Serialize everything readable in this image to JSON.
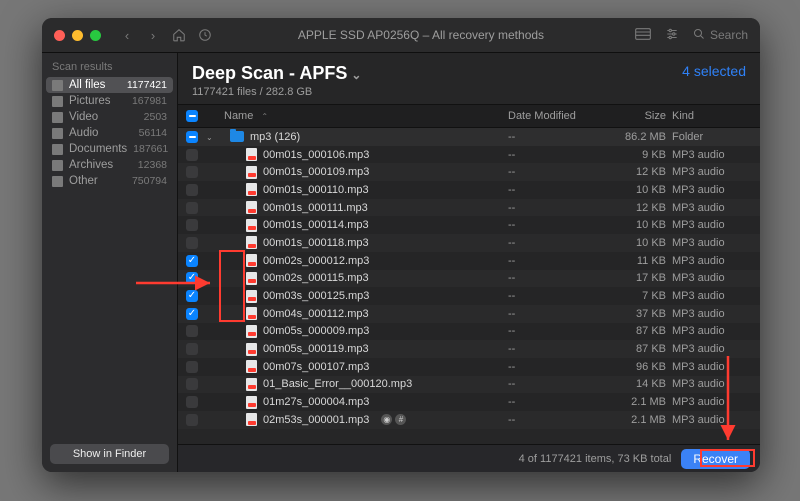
{
  "titlebar": {
    "title": "APPLE SSD AP0256Q – All recovery methods",
    "search_placeholder": "Search"
  },
  "sidebar": {
    "header": "Scan results",
    "items": [
      {
        "label": "All files",
        "count": "1177421"
      },
      {
        "label": "Pictures",
        "count": "167981"
      },
      {
        "label": "Video",
        "count": "2503"
      },
      {
        "label": "Audio",
        "count": "56114"
      },
      {
        "label": "Documents",
        "count": "187661"
      },
      {
        "label": "Archives",
        "count": "12368"
      },
      {
        "label": "Other",
        "count": "750794"
      }
    ],
    "finder_button": "Show in Finder"
  },
  "content": {
    "title": "Deep Scan - APFS",
    "subtitle": "1177421 files / 282.8 GB",
    "selected_label": "4 selected"
  },
  "columns": {
    "name": "Name",
    "date": "Date Modified",
    "size": "Size",
    "kind": "Kind"
  },
  "rows": [
    {
      "check": "head",
      "disclosure": "down",
      "icon": "folder",
      "depth": 0,
      "name": "mp3 (126)",
      "date": "--",
      "size": "86.2 MB",
      "kind": "Folder",
      "folder": true,
      "badges": false
    },
    {
      "check": "off",
      "disclosure": "",
      "icon": "file",
      "depth": 1,
      "name": "00m01s_000106.mp3",
      "date": "--",
      "size": "9 KB",
      "kind": "MP3 audio",
      "badges": false
    },
    {
      "check": "off",
      "disclosure": "",
      "icon": "file",
      "depth": 1,
      "name": "00m01s_000109.mp3",
      "date": "--",
      "size": "12 KB",
      "kind": "MP3 audio",
      "badges": false
    },
    {
      "check": "off",
      "disclosure": "",
      "icon": "file",
      "depth": 1,
      "name": "00m01s_000110.mp3",
      "date": "--",
      "size": "10 KB",
      "kind": "MP3 audio",
      "badges": false
    },
    {
      "check": "off",
      "disclosure": "",
      "icon": "file",
      "depth": 1,
      "name": "00m01s_000111.mp3",
      "date": "--",
      "size": "12 KB",
      "kind": "MP3 audio",
      "badges": false
    },
    {
      "check": "off",
      "disclosure": "",
      "icon": "file",
      "depth": 1,
      "name": "00m01s_000114.mp3",
      "date": "--",
      "size": "10 KB",
      "kind": "MP3 audio",
      "badges": false
    },
    {
      "check": "off",
      "disclosure": "",
      "icon": "file",
      "depth": 1,
      "name": "00m01s_000118.mp3",
      "date": "--",
      "size": "10 KB",
      "kind": "MP3 audio",
      "badges": false
    },
    {
      "check": "on",
      "disclosure": "",
      "icon": "file",
      "depth": 1,
      "name": "00m02s_000012.mp3",
      "date": "--",
      "size": "11 KB",
      "kind": "MP3 audio",
      "badges": false
    },
    {
      "check": "on",
      "disclosure": "",
      "icon": "file",
      "depth": 1,
      "name": "00m02s_000115.mp3",
      "date": "--",
      "size": "17 KB",
      "kind": "MP3 audio",
      "badges": false
    },
    {
      "check": "on",
      "disclosure": "",
      "icon": "file",
      "depth": 1,
      "name": "00m03s_000125.mp3",
      "date": "--",
      "size": "7 KB",
      "kind": "MP3 audio",
      "badges": false
    },
    {
      "check": "on",
      "disclosure": "",
      "icon": "file",
      "depth": 1,
      "name": "00m04s_000112.mp3",
      "date": "--",
      "size": "37 KB",
      "kind": "MP3 audio",
      "badges": false
    },
    {
      "check": "off",
      "disclosure": "",
      "icon": "file",
      "depth": 1,
      "name": "00m05s_000009.mp3",
      "date": "--",
      "size": "87 KB",
      "kind": "MP3 audio",
      "badges": false
    },
    {
      "check": "off",
      "disclosure": "",
      "icon": "file",
      "depth": 1,
      "name": "00m05s_000119.mp3",
      "date": "--",
      "size": "87 KB",
      "kind": "MP3 audio",
      "badges": false
    },
    {
      "check": "off",
      "disclosure": "",
      "icon": "file",
      "depth": 1,
      "name": "00m07s_000107.mp3",
      "date": "--",
      "size": "96 KB",
      "kind": "MP3 audio",
      "badges": false
    },
    {
      "check": "off",
      "disclosure": "",
      "icon": "file",
      "depth": 1,
      "name": "01_Basic_Error__000120.mp3",
      "date": "--",
      "size": "14 KB",
      "kind": "MP3 audio",
      "badges": false
    },
    {
      "check": "off",
      "disclosure": "",
      "icon": "file",
      "depth": 1,
      "name": "01m27s_000004.mp3",
      "date": "--",
      "size": "2.1 MB",
      "kind": "MP3 audio",
      "badges": false
    },
    {
      "check": "off",
      "disclosure": "",
      "icon": "file",
      "depth": 1,
      "name": "02m53s_000001.mp3",
      "date": "--",
      "size": "2.1 MB",
      "kind": "MP3 audio",
      "badges": true
    }
  ],
  "footer": {
    "status": "4 of 1177421 items, 73 KB total",
    "recover_label": "Recover"
  }
}
